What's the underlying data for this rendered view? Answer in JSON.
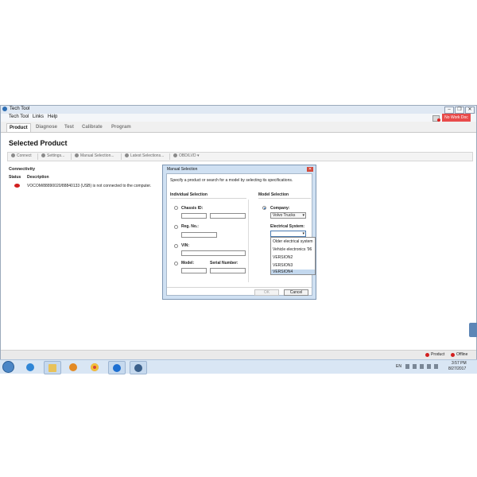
{
  "window": {
    "title": "Tech Tool",
    "controls": [
      "–",
      "❐",
      "✕"
    ],
    "alert_label": "No Work Doc"
  },
  "menu": [
    "Tech Tool",
    "Links",
    "Help"
  ],
  "tabs": [
    {
      "label": "Product",
      "active": true
    },
    {
      "label": "Diagnose",
      "active": false
    },
    {
      "label": "Test",
      "active": false
    },
    {
      "label": "Calibrate",
      "active": false
    },
    {
      "label": "Program",
      "active": false
    }
  ],
  "page_title": "Selected Product",
  "toolbar": {
    "connect": "Connect",
    "settings": "Settings...",
    "manual_selection": "Manual Selection...",
    "latest_selections": "Latest Selections...",
    "obd": "OBD/LVD ▾"
  },
  "connectivity": {
    "label": "Connectivity",
    "headers": [
      "Status",
      "Description"
    ],
    "rows": [
      {
        "status_color": "#d21f1f",
        "description": "VOCOM/88890020/88840133 (USB) is not connected to the computer."
      }
    ]
  },
  "statusbar": {
    "product": "Product",
    "offline": "Offline"
  },
  "dialog": {
    "title": "Manual Selection",
    "instruction": "Specify a product or search for a model by selecting its specifications.",
    "individual_heading": "Individual Selection",
    "model_heading": "Model Selection",
    "chassis_label": "Chassis ID:",
    "reg_label": "Reg. No.:",
    "vin_label": "VIN:",
    "model_label": "Model:",
    "serial_label": "Serial Number:",
    "company_label": "Company:",
    "company_value": "Volvo Trucks",
    "electrical_label": "Electrical System:",
    "electrical_options": [
      "Older electrical system",
      "Vehicle electronics '96",
      "VERSION2",
      "VERSION3",
      "VERSION4"
    ],
    "electrical_highlighted": "VERSION4",
    "ok": "OK",
    "cancel": "Cancel"
  },
  "taskbar": {
    "language": "EN",
    "time": "3:57 PM",
    "date": "8/27/2017"
  },
  "colors": {
    "accent": "#2f6fb4",
    "alert": "#e84b4b",
    "status_error": "#d21f1f"
  }
}
